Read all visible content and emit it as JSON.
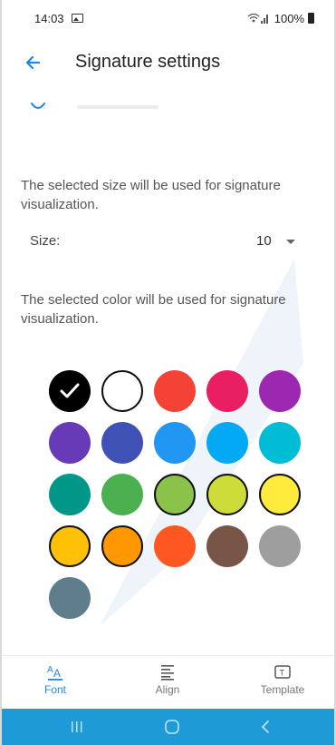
{
  "status_bar": {
    "time": "14:03",
    "battery": "100%"
  },
  "app_bar": {
    "title": "Signature settings"
  },
  "size_section": {
    "description": "The selected size will be used for signature visualization.",
    "label": "Size:",
    "value": "10"
  },
  "color_section": {
    "description": "The selected color will be used for signature visualization.",
    "swatches": [
      {
        "name": "black",
        "color": "#000000",
        "selected": true
      },
      {
        "name": "white",
        "color": "#ffffff",
        "selected": false
      },
      {
        "name": "red",
        "color": "#f44336",
        "selected": false
      },
      {
        "name": "pink",
        "color": "#e91e63",
        "selected": false
      },
      {
        "name": "purple",
        "color": "#9c27b0",
        "selected": false
      },
      {
        "name": "deep-purple",
        "color": "#673ab7",
        "selected": false
      },
      {
        "name": "indigo",
        "color": "#3f51b5",
        "selected": false
      },
      {
        "name": "blue",
        "color": "#2196f3",
        "selected": false
      },
      {
        "name": "light-blue",
        "color": "#03a9f4",
        "selected": false
      },
      {
        "name": "cyan",
        "color": "#00bcd4",
        "selected": false
      },
      {
        "name": "teal",
        "color": "#009688",
        "selected": false
      },
      {
        "name": "green",
        "color": "#4caf50",
        "selected": false
      },
      {
        "name": "light-green",
        "color": "#8bc34a",
        "selected": false
      },
      {
        "name": "lime",
        "color": "#cddc39",
        "selected": false
      },
      {
        "name": "yellow",
        "color": "#ffeb3b",
        "selected": false
      },
      {
        "name": "amber",
        "color": "#ffc107",
        "selected": false
      },
      {
        "name": "orange",
        "color": "#ff9800",
        "selected": false
      },
      {
        "name": "deep-orange",
        "color": "#ff5722",
        "selected": false
      },
      {
        "name": "brown",
        "color": "#795548",
        "selected": false
      },
      {
        "name": "grey",
        "color": "#9e9e9e",
        "selected": false
      },
      {
        "name": "blue-grey",
        "color": "#607d8b",
        "selected": false
      }
    ]
  },
  "bottom_nav": {
    "items": [
      {
        "label": "Font",
        "icon": "font-icon",
        "active": true
      },
      {
        "label": "Align",
        "icon": "align-icon",
        "active": false
      },
      {
        "label": "Template",
        "icon": "template-icon",
        "active": false
      }
    ]
  },
  "colors": {
    "accent": "#1e88e5",
    "system_nav": "#1e9ad6"
  }
}
